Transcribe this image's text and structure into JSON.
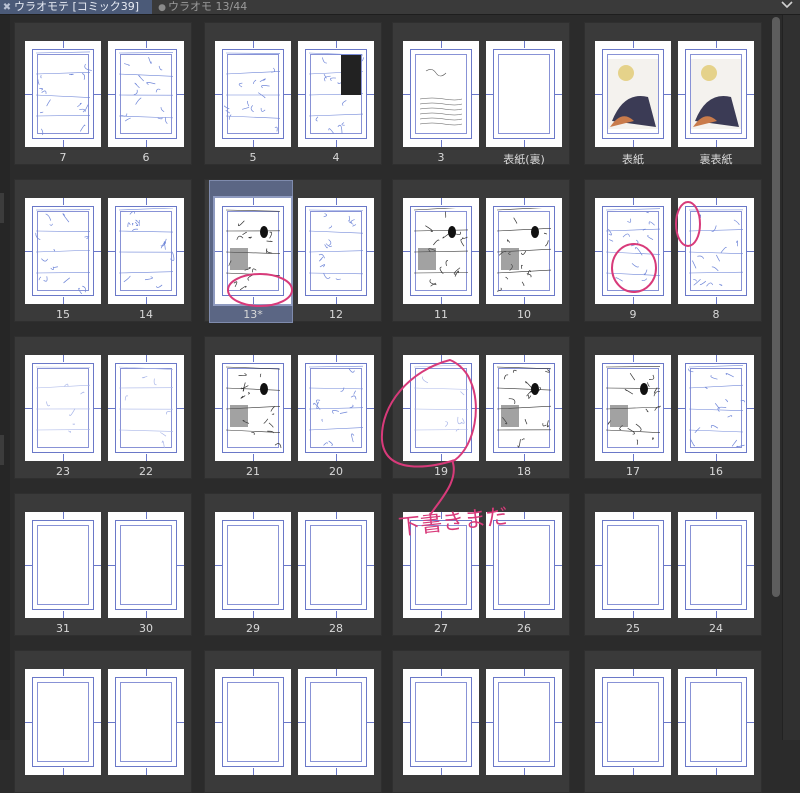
{
  "tabs": [
    {
      "label": "ウラオモテ [コミック39]",
      "active": true
    },
    {
      "label": "ウラオモ 13/44",
      "active": false
    }
  ],
  "annotation_text": "下書きまだ",
  "colors": {
    "accent_selection": "#5b6684",
    "pencil": "#6a78c8",
    "marker": "#d83a7a"
  },
  "spreads": [
    {
      "left": "7",
      "right": "6",
      "left_style": "sketch",
      "right_style": "sketch"
    },
    {
      "left": "5",
      "right": "4",
      "left_style": "sketch",
      "right_style": "sketch_dark"
    },
    {
      "left": "3",
      "right": "表紙(裏)",
      "left_style": "notes",
      "right_style": "blank"
    },
    {
      "left": "表紙",
      "right": "裏表紙",
      "left_style": "cover",
      "right_style": "cover"
    },
    {
      "left": "15",
      "right": "14",
      "left_style": "sketch",
      "right_style": "sketch"
    },
    {
      "left": "13*",
      "right": "12",
      "left_style": "inked",
      "right_style": "sketch",
      "selected_left": true
    },
    {
      "left": "11",
      "right": "10",
      "left_style": "inked",
      "right_style": "inked"
    },
    {
      "left": "9",
      "right": "8",
      "left_style": "sketch",
      "right_style": "sketch"
    },
    {
      "left": "23",
      "right": "22",
      "left_style": "faint",
      "right_style": "faint"
    },
    {
      "left": "21",
      "right": "20",
      "left_style": "inked",
      "right_style": "sketch"
    },
    {
      "left": "19",
      "right": "18",
      "left_style": "faint",
      "right_style": "inked"
    },
    {
      "left": "17",
      "right": "16",
      "left_style": "inked",
      "right_style": "sketch"
    },
    {
      "left": "31",
      "right": "30",
      "left_style": "blank",
      "right_style": "blank"
    },
    {
      "left": "29",
      "right": "28",
      "left_style": "blank",
      "right_style": "blank"
    },
    {
      "left": "27",
      "right": "26",
      "left_style": "blank",
      "right_style": "blank"
    },
    {
      "left": "25",
      "right": "24",
      "left_style": "blank",
      "right_style": "blank"
    },
    {
      "left": "",
      "right": "",
      "left_style": "blank",
      "right_style": "blank"
    },
    {
      "left": "",
      "right": "",
      "left_style": "blank",
      "right_style": "blank"
    },
    {
      "left": "",
      "right": "",
      "left_style": "blank",
      "right_style": "blank"
    },
    {
      "left": "",
      "right": "",
      "left_style": "blank",
      "right_style": "blank"
    }
  ]
}
